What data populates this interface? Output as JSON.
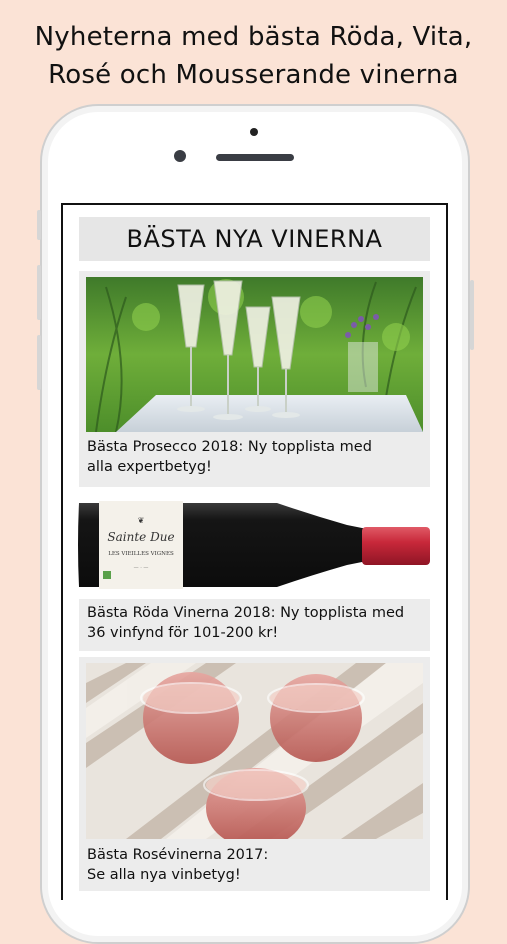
{
  "header": {
    "line1": "Nyheterna med bästa Röda, Vita,",
    "line2": "Rosé och Mousserande vinerna"
  },
  "screen": {
    "title": "BÄSTA NYA VINERNA",
    "articles": [
      {
        "line1": "Bästa Prosecco 2018: Ny topplista med",
        "line2": "alla expertbetyg!",
        "image": "prosecco-glasses-photo"
      },
      {
        "line1": "Bästa Röda Vinerna 2018: Ny topplista med",
        "line2": "36 vinfynd för 101-200 kr!",
        "image": "red-wine-bottle-photo",
        "label_text": "Sainte Due",
        "label_sub": "LES VIEILLES VIGNES"
      },
      {
        "line1": "Bästa Rosévinerna 2017:",
        "line2": "Se alla nya vinbetyg!",
        "image": "rose-wine-glasses-photo"
      }
    ]
  },
  "colors": {
    "background": "#fbe3d6",
    "card": "#ececec",
    "title_bar": "#e6e6e6",
    "bottle_capsule": "#c8283a"
  }
}
